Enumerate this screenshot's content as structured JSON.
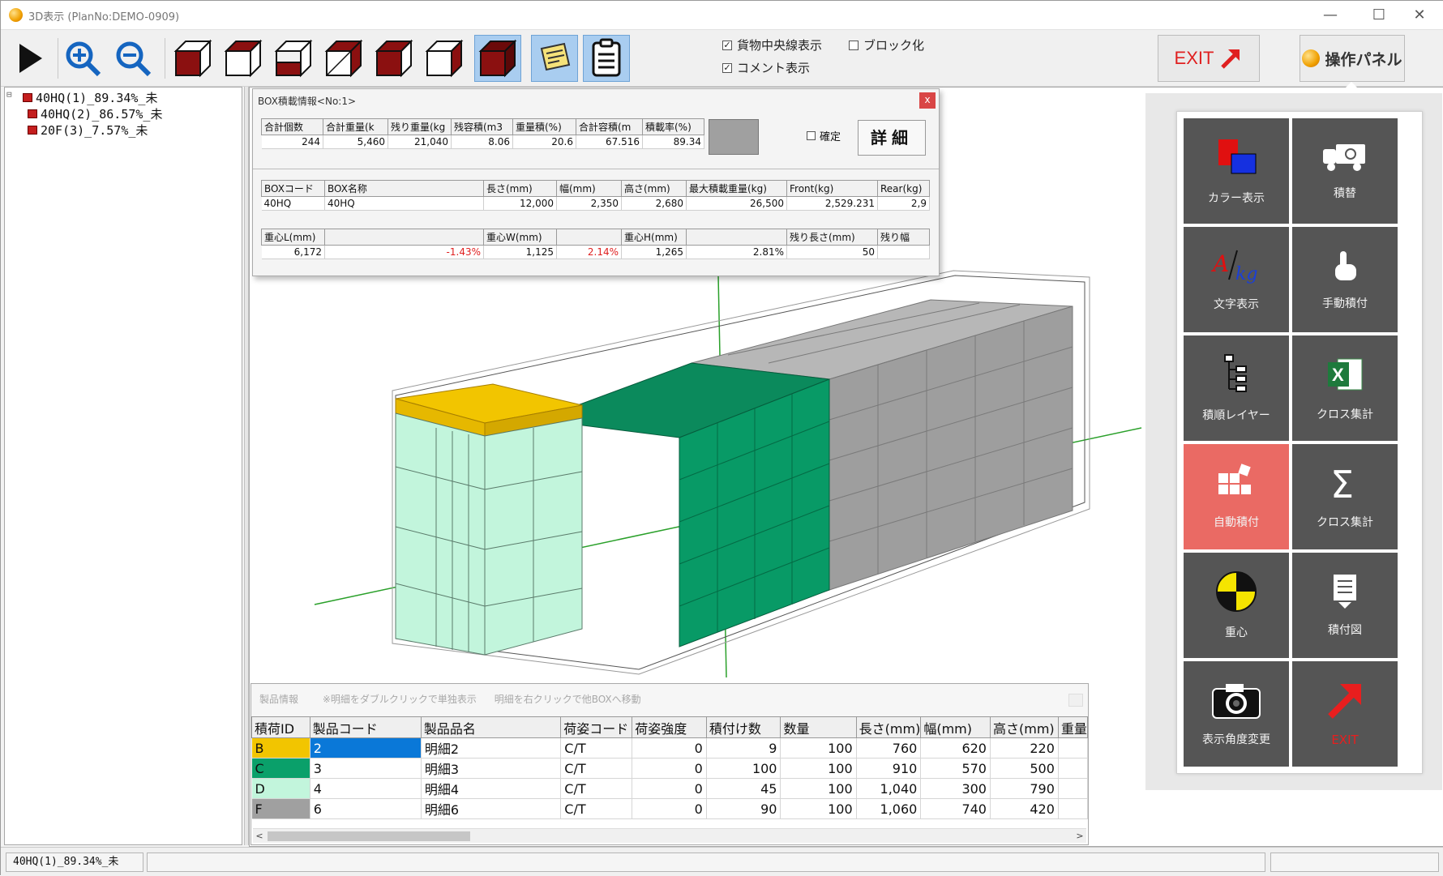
{
  "window": {
    "title": "3D表示 (PlanNo:DEMO-0909)",
    "minimize": "—",
    "maximize": "☐",
    "close": "✕"
  },
  "toolbar": {
    "chk_center_line": "貨物中央線表示",
    "chk_comment": "コメント表示",
    "chk_block": "ブロック化",
    "exit_label": "EXIT",
    "panel_label": "操作パネル"
  },
  "tree": {
    "expander": "⊟",
    "items": [
      "40HQ(1)_89.34%_未",
      "40HQ(2)_86.57%_未",
      "20F(3)_7.57%_未"
    ]
  },
  "box_info": {
    "title": "BOX積載情報<No:1>",
    "close": "x",
    "summary_headers": [
      "合計個数",
      "合計重量(k",
      "残り重量(kg",
      "残容積(m3",
      "重量積(%)",
      "合計容積(m",
      "積載率(%)"
    ],
    "summary_values": [
      "244",
      "5,460",
      "21,040",
      "8.06",
      "20.6",
      "67.516",
      "89.34"
    ],
    "confirm_label": "確定",
    "detail_label": "詳細",
    "box_headers": [
      "BOXコード",
      "BOX名称",
      "長さ(mm)",
      "幅(mm)",
      "高さ(mm)",
      "最大積載重量(kg)",
      "Front(kg)",
      "Rear(kg)"
    ],
    "box_values": [
      "40HQ",
      "40HQ",
      "12,000",
      "2,350",
      "2,680",
      "26,500",
      "2,529.231",
      "2,9"
    ],
    "cog_headers": [
      "重心L(mm)",
      "",
      "重心W(mm)",
      "",
      "重心H(mm)",
      "",
      "残り長さ(mm)",
      "残り幅"
    ],
    "cog_values": [
      "6,172",
      "-1.43%",
      "1,125",
      "2.14%",
      "1,265",
      "2.81%",
      "50",
      ""
    ]
  },
  "product_info": {
    "header_title": "製品情報",
    "header_hint1": "※明細をダブルクリックで単独表示",
    "header_hint2": "明細を右クリックで他BOXへ移動",
    "columns": [
      "積荷ID",
      "製品コード",
      "製品品名",
      "荷姿コード",
      "荷姿強度",
      "積付け数",
      "数量",
      "長さ(mm)",
      "幅(mm)",
      "高さ(mm)",
      "重量"
    ],
    "rows": [
      {
        "id": "B",
        "code": "2",
        "name": "明細2",
        "pack": "C/T",
        "strength": "0",
        "stack": "9",
        "qty": "100",
        "len": "760",
        "wid": "620",
        "hgt": "220",
        "color": "#f2c500"
      },
      {
        "id": "C",
        "code": "3",
        "name": "明細3",
        "pack": "C/T",
        "strength": "0",
        "stack": "100",
        "qty": "100",
        "len": "910",
        "wid": "570",
        "hgt": "500",
        "color": "#0aa06a"
      },
      {
        "id": "D",
        "code": "4",
        "name": "明細4",
        "pack": "C/T",
        "strength": "0",
        "stack": "45",
        "qty": "100",
        "len": "1,040",
        "wid": "300",
        "hgt": "790",
        "color": "#c2f5dc"
      },
      {
        "id": "F",
        "code": "6",
        "name": "明細6",
        "pack": "C/T",
        "strength": "0",
        "stack": "90",
        "qty": "100",
        "len": "1,060",
        "wid": "740",
        "hgt": "420",
        "color": "#a0a0a0"
      }
    ],
    "scroll_left": "<",
    "scroll_right": ">"
  },
  "operation_panel": {
    "buttons": [
      {
        "label": "カラー表示",
        "icon": "color-icon"
      },
      {
        "label": "積替",
        "icon": "truck-icon"
      },
      {
        "label": "文字表示",
        "icon": "text-akg-icon"
      },
      {
        "label": "手動積付",
        "icon": "hand-pointer-icon"
      },
      {
        "label": "積順レイヤー",
        "icon": "layer-tree-icon"
      },
      {
        "label": "クロス集計",
        "icon": "excel-icon"
      },
      {
        "label": "自動積付",
        "icon": "auto-stack-icon"
      },
      {
        "label": "クロス集計",
        "icon": "sigma-icon"
      },
      {
        "label": "重心",
        "icon": "center-gravity-icon"
      },
      {
        "label": "積付図",
        "icon": "document-icon"
      },
      {
        "label": "表示角度変更",
        "icon": "camera-icon"
      },
      {
        "label": "EXIT",
        "icon": "exit-arrow-icon"
      }
    ]
  },
  "status": {
    "current_box": "40HQ(1)_89.34%_未"
  },
  "colors": {
    "accent": "#a9cdf0",
    "gray_cargo": "#a0a0a0",
    "green_cargo": "#0aa06a",
    "yellow_cargo": "#f2c500",
    "mint_cargo": "#c2f5dc",
    "op_button": "#555555",
    "op_button_active": "#ea6a64"
  }
}
